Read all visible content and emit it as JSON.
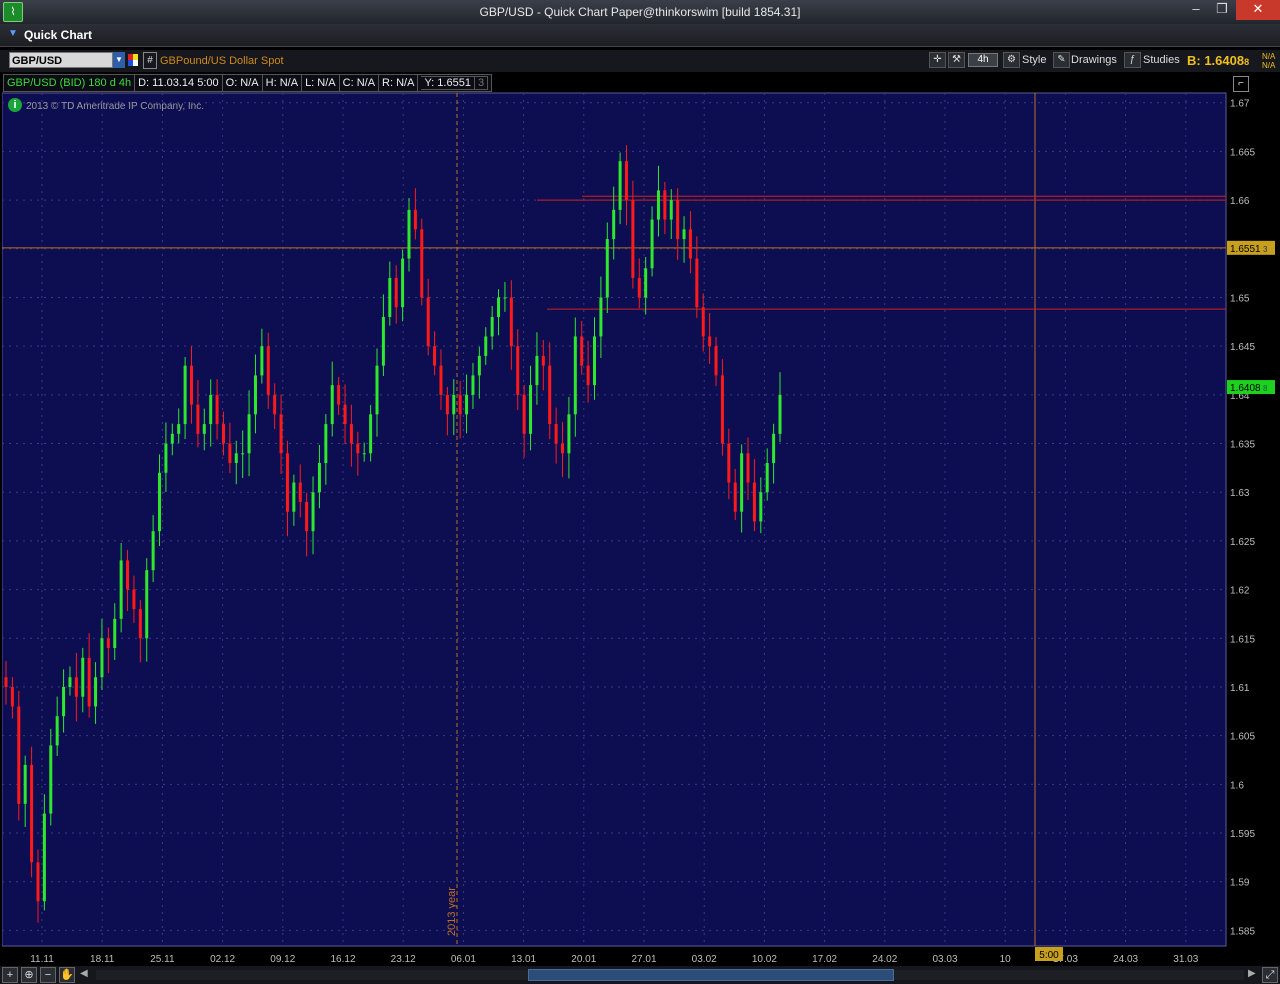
{
  "window": {
    "title": "GBP/USD - Quick Chart Paper@thinkorswim [build 1854.31]",
    "minimize": "–",
    "restore": "❐",
    "close": "✕"
  },
  "panel": {
    "label": "Quick Chart"
  },
  "toolbar": {
    "symbol": "GBP/USD",
    "hash": "#",
    "description": "GBPound/US Dollar Spot",
    "aggregation": "4h",
    "style_label": "Style",
    "drawings_label": "Drawings",
    "studies_label": "Studies",
    "bid": "B: 1.6408",
    "bid_small": "8",
    "na1": "N/A",
    "na2": "N/A"
  },
  "infobar": {
    "series": "GBP/USD (BID) 180 d 4h",
    "date": "D: 11.03.14 5:00",
    "open": "O: N/A",
    "high": "H: N/A",
    "low": "L: N/A",
    "close": "C: N/A",
    "range": "R: N/A",
    "y": "Y: 1.6551",
    "y_small": "3"
  },
  "copyright": "2013 © TD Ameritrade IP Company, Inc.",
  "colors": {
    "bg": "#0d0d52",
    "up": "#2ee82e",
    "down": "#ff1a1a",
    "grid": "#3a3a8a",
    "accent": "#c07020"
  },
  "chart_data": {
    "type": "candlestick",
    "y_ticks": [
      "1.67",
      "1.665",
      "1.66",
      "1.655",
      "1.65",
      "1.645",
      "1.64",
      "1.635",
      "1.63",
      "1.625",
      "1.62",
      "1.615",
      "1.61",
      "1.605",
      "1.6",
      "1.595",
      "1.59",
      "1.585"
    ],
    "ylim": [
      1.5834,
      1.671
    ],
    "x_ticks": [
      "11.11",
      "18.11",
      "25.11",
      "02.12",
      "09.12",
      "16.12",
      "23.12",
      "06.01",
      "13.01",
      "20.01",
      "27.01",
      "03.02",
      "10.02",
      "17.02",
      "24.02",
      "03.03",
      "10",
      "17.03",
      "24.03",
      "31.03"
    ],
    "year_marker": "2013 year",
    "cursor_time": "5:00",
    "cursor_price": "1.6551",
    "cursor_price_small": "3",
    "last_price": "1.6408",
    "last_price_small": "8",
    "horizontal_lines": [
      1.6604,
      1.66,
      1.6551,
      1.6488
    ],
    "series": [
      {
        "name": "GBP/USD",
        "close": [
          1.61,
          1.608,
          1.598,
          1.602,
          1.592,
          1.588,
          1.597,
          1.604,
          1.607,
          1.61,
          1.611,
          1.609,
          1.613,
          1.608,
          1.611,
          1.615,
          1.614,
          1.617,
          1.623,
          1.62,
          1.618,
          1.615,
          1.622,
          1.626,
          1.632,
          1.635,
          1.636,
          1.637,
          1.643,
          1.639,
          1.636,
          1.637,
          1.64,
          1.637,
          1.635,
          1.633,
          1.634,
          1.634,
          1.638,
          1.642,
          1.645,
          1.64,
          1.638,
          1.634,
          1.628,
          1.631,
          1.629,
          1.626,
          1.63,
          1.633,
          1.637,
          1.641,
          1.639,
          1.637,
          1.635,
          1.634,
          1.634,
          1.638,
          1.643,
          1.648,
          1.652,
          1.649,
          1.654,
          1.659,
          1.657,
          1.65,
          1.645,
          1.643,
          1.64,
          1.638,
          1.64,
          1.638,
          1.64,
          1.642,
          1.644,
          1.646,
          1.648,
          1.65,
          1.65,
          1.645,
          1.64,
          1.636,
          1.641,
          1.644,
          1.643,
          1.637,
          1.635,
          1.634,
          1.638,
          1.646,
          1.643,
          1.641,
          1.646,
          1.65,
          1.656,
          1.659,
          1.664,
          1.66,
          1.652,
          1.65,
          1.653,
          1.658,
          1.661,
          1.658,
          1.66,
          1.656,
          1.657,
          1.654,
          1.649,
          1.646,
          1.645,
          1.642,
          1.635,
          1.631,
          1.628,
          1.634,
          1.631,
          1.627,
          1.63,
          1.633,
          1.636,
          1.64
        ]
      }
    ]
  }
}
